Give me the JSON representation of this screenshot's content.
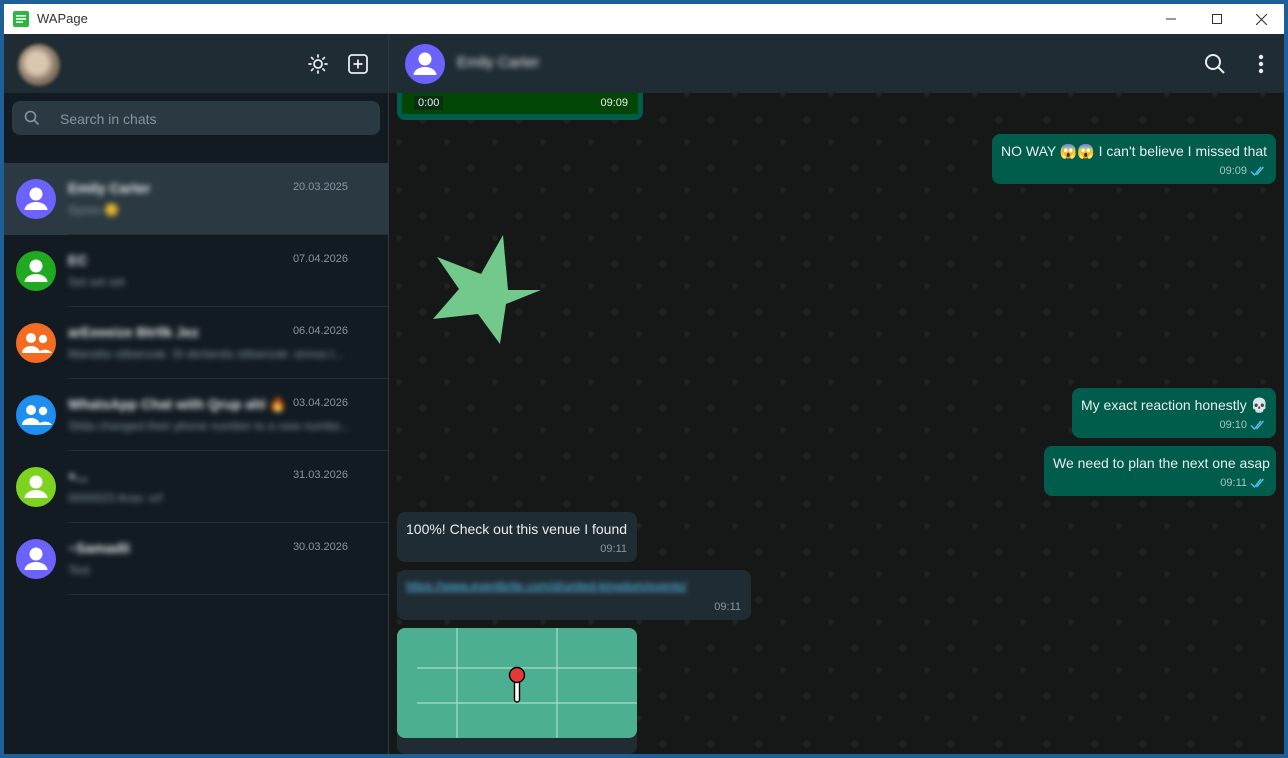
{
  "window": {
    "title": "WAPage",
    "minimize": "—",
    "maximize": "☐",
    "close": "✕"
  },
  "sidebar": {
    "search": {
      "placeholder": "Search in chats"
    },
    "chats": [
      {
        "name": "Emily Carter",
        "preview": "Sysso 😊",
        "date": "20.03.2025",
        "avatar_color": "#6c63ff",
        "group": false,
        "active": true
      },
      {
        "name": "EC",
        "preview": "Set set set",
        "date": "07.04.2026",
        "avatar_color": "#1faa1f",
        "group": false,
        "active": false
      },
      {
        "name": "arEeeeize Btrllk Jez",
        "preview": "Manatta stibanzak: St derlanda stibanzak: annsa t...",
        "date": "06.04.2026",
        "avatar_color": "#f36c21",
        "group": true,
        "active": false
      },
      {
        "name": "WhatsApp Chat with Qrup ahl 🔥",
        "preview": "Silda changed their phone number to a new numbe...",
        "date": "03.04.2026",
        "avatar_color": "#1f8ef1",
        "group": true,
        "active": false
      },
      {
        "name": "+...",
        "preview": "0000023 Aras: vrf",
        "date": "31.03.2026",
        "avatar_color": "#7ed321",
        "group": false,
        "active": false
      },
      {
        "name": "~Samadli",
        "preview": "Test",
        "date": "30.03.2026",
        "avatar_color": "#6c63ff",
        "group": false,
        "active": false
      }
    ]
  },
  "conversation": {
    "contact_name": "Emily Carter",
    "contact_avatar_color": "#6c63ff",
    "voice_note": {
      "duration": "0:00",
      "time": "09:09"
    },
    "messages": [
      {
        "direction": "out",
        "text": "NO WAY 😱😱 I can't believe I missed that",
        "time": "09:09"
      },
      {
        "direction": "out",
        "text": "My exact reaction honestly 💀",
        "time": "09:10"
      },
      {
        "direction": "out",
        "text": "We need to plan the next one asap",
        "time": "09:11"
      },
      {
        "direction": "in",
        "text": "100%! Check out this venue I found",
        "time": "09:11"
      },
      {
        "direction": "in",
        "text": "https://www.eventbrite.com/d/united-kingdom/events/",
        "time": "09:11"
      }
    ]
  },
  "colors": {
    "accent": "#00a884",
    "outgoing_bubble": "#005c4b",
    "incoming_bubble": "#202c33",
    "sticker": "#73c98c",
    "map": "#4caf91",
    "pin": "#e53935"
  },
  "icons": {
    "theme": "sun-icon",
    "new_chat": "new-chat-icon",
    "search": "search-icon",
    "menu": "vertical-dots-icon"
  }
}
